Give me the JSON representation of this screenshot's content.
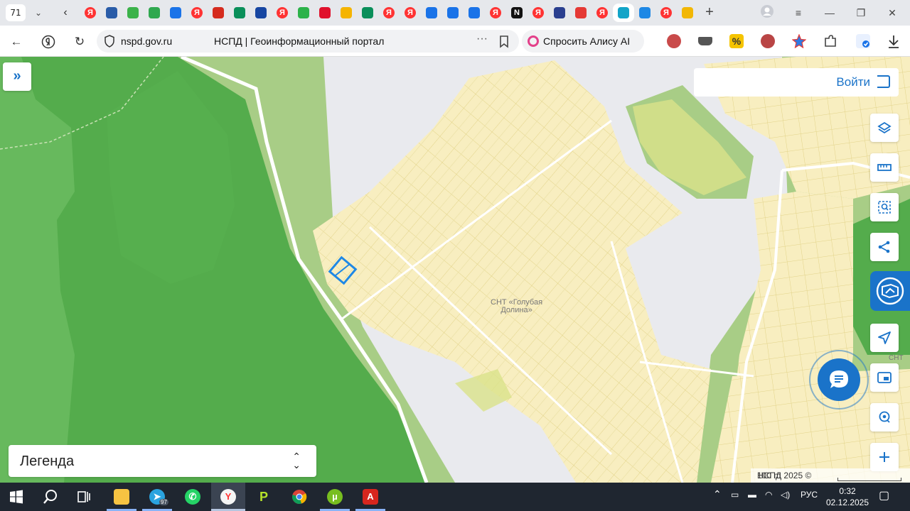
{
  "browser": {
    "tab_count": "71",
    "url_host": "nspd.gov.ru",
    "page_title": "НСПД | Геоинформационный портал",
    "alice_label": "Спросить Алису AI",
    "tabs": [
      {
        "icon": "yandex-icon",
        "color": "#f33"
      },
      {
        "icon": "gov-emblem-icon",
        "color": "#2a5ca8"
      },
      {
        "icon": "dots-app-icon",
        "color": "#3bb24a"
      },
      {
        "icon": "dots-app-icon",
        "color": "#2fa84f"
      },
      {
        "icon": "maps-arrow-icon",
        "color": "#1a73e8"
      },
      {
        "icon": "yandex-icon",
        "color": "#f33"
      },
      {
        "icon": "russia-flag-icon",
        "color": "#d52b1e"
      },
      {
        "icon": "star-app-icon",
        "color": "#0a8f5a"
      },
      {
        "icon": "cross-app-icon",
        "color": "#1746a2"
      },
      {
        "icon": "yandex-icon",
        "color": "#f33"
      },
      {
        "icon": "circle-app-icon",
        "color": "#2cb24a"
      },
      {
        "icon": "chat-app-icon",
        "color": "#e0112c"
      },
      {
        "icon": "home-app-icon",
        "color": "#f5b400"
      },
      {
        "icon": "star-app-icon",
        "color": "#0a8f5a"
      },
      {
        "icon": "yandex-icon",
        "color": "#f33"
      },
      {
        "icon": "yandex-icon",
        "color": "#f33"
      },
      {
        "icon": "maps-arrow-icon",
        "color": "#1a73e8"
      },
      {
        "icon": "maps-arrow-icon",
        "color": "#1a73e8"
      },
      {
        "icon": "maps-arrow-icon",
        "color": "#1a73e8"
      },
      {
        "icon": "yandex-icon",
        "color": "#f33"
      },
      {
        "icon": "notion-icon",
        "color": "#111"
      },
      {
        "icon": "yandex-icon",
        "color": "#f33"
      },
      {
        "icon": "emblem-icon",
        "color": "#2a3f8f"
      },
      {
        "icon": "map-pin-icon",
        "color": "#e53935"
      },
      {
        "icon": "yandex-icon",
        "color": "#f33"
      },
      {
        "icon": "nspd-icon",
        "color": "#12a4c8"
      },
      {
        "icon": "gov-services-icon",
        "color": "#1e88e5"
      },
      {
        "icon": "yandex-icon",
        "color": "#f33"
      },
      {
        "icon": "mountain-icon",
        "color": "#f2b705"
      }
    ]
  },
  "map": {
    "place_label_line1": "СНТ «Голубая",
    "place_label_line2": "Долина»",
    "edge_label": "СНТ",
    "login_label": "Войти",
    "legend_label": "Легенда",
    "attribution": "НСПД 2025 ©",
    "scale_label": "100 m",
    "colors": {
      "forest": "#54ac4c",
      "meadow": "#a8cd86",
      "parcel": "#f8eec0",
      "parcel_edge": "#e6d88e",
      "road": "#ffffff",
      "accent": "#1a73c9",
      "selected": "#1e88e5"
    }
  },
  "taskbar": {
    "lang": "РУС",
    "time": "0:32",
    "date": "02.12.2025",
    "telegram_badge": "97"
  }
}
